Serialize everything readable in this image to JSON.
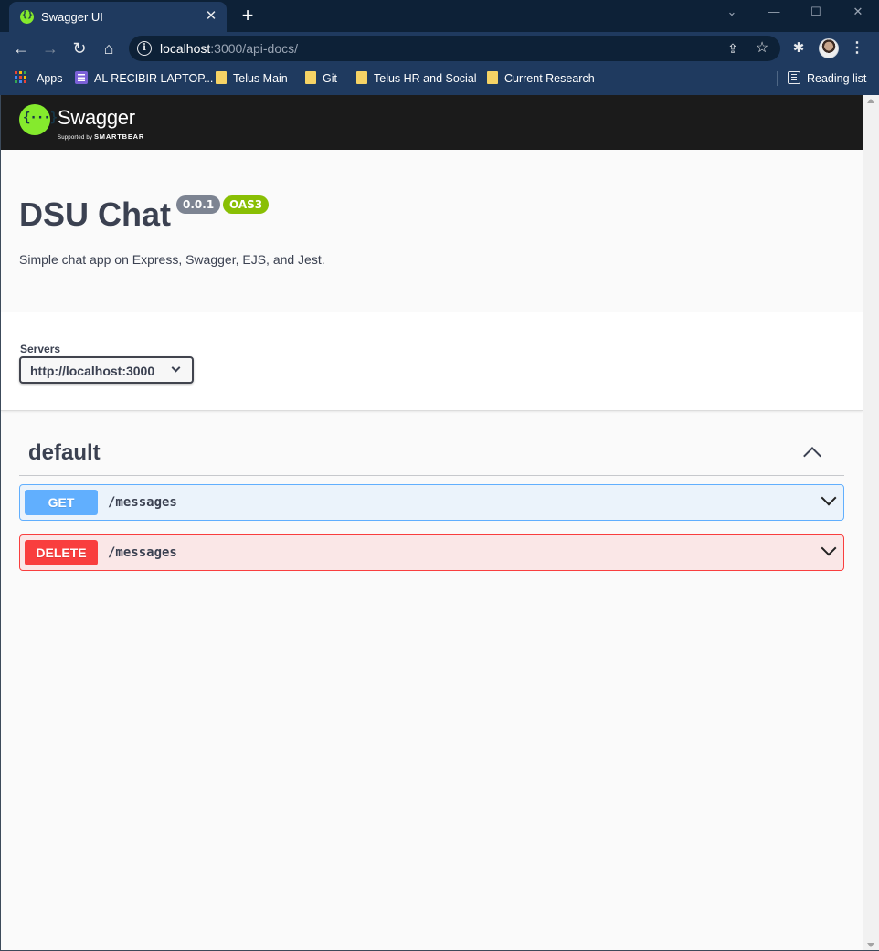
{
  "browser": {
    "tab_title": "Swagger UI",
    "tab_close": "✕",
    "new_tab": "+",
    "url_host": "localhost",
    "url_rest": ":3000/api-docs/",
    "bookmarks": [
      {
        "label": "Apps",
        "icon": "apps-icon"
      },
      {
        "label": "AL RECIBIR LAPTOP...",
        "icon": "list-icon"
      },
      {
        "label": "Telus Main",
        "icon": "folder-icon"
      },
      {
        "label": "Git",
        "icon": "folder-icon"
      },
      {
        "label": "Telus HR and Social",
        "icon": "folder-icon"
      },
      {
        "label": "Current Research",
        "icon": "folder-icon"
      }
    ],
    "reading_list": "Reading list",
    "theme_color": "#1f3a5f"
  },
  "swagger": {
    "brand": "Swagger",
    "brand_sub_prefix": "Supported by",
    "brand_sub_company": "SMARTBEAR",
    "logo_glyph": "{···}"
  },
  "info": {
    "title": "DSU Chat",
    "version": "0.0.1",
    "spec": "OAS3",
    "description": "Simple chat app on Express, Swagger, EJS, and Jest."
  },
  "servers": {
    "label": "Servers",
    "selected": "http://localhost:3000"
  },
  "tag": {
    "name": "default",
    "operations": [
      {
        "method": "GET",
        "path": "/messages",
        "color": "#61affe"
      },
      {
        "method": "DELETE",
        "path": "/messages",
        "color": "#f93e3e"
      }
    ]
  }
}
